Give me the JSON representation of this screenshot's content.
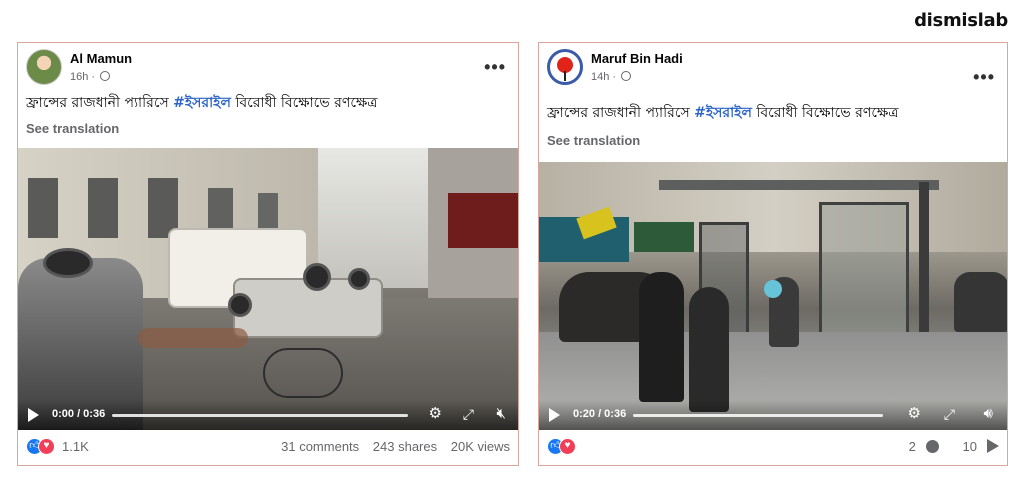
{
  "brand": "dismislab",
  "posts": [
    {
      "author": "Al Mamun",
      "time": "16h ·",
      "text_before": "ফ্রান্সের রাজধানী প্যারিসে ",
      "hashtag": "#ইসরাইল",
      "text_after": " বিরোধী বিক্ষোভে রণক্ষেত্র",
      "see_translation": "See translation",
      "video": {
        "time": "0:00 / 0:36",
        "progress": 0
      },
      "reaction_count": "1.1K",
      "comments": "31 comments",
      "shares": "243 shares",
      "views": "20K views",
      "icons": {
        "more": "more-options-icon",
        "globe": "globe-icon",
        "play": "play-icon",
        "settings": "settings-icon",
        "fullscreen": "fullscreen-icon",
        "mute": "mute-icon"
      }
    },
    {
      "author": "Maruf Bin Hadi",
      "time": "14h ·",
      "text_before": "ফ্রান্সের রাজধানী প্যারিসে ",
      "hashtag": "#ইসরাইল",
      "text_after": " বিরোধী বিক্ষোভে রণক্ষেত্র",
      "see_translation": "See translation",
      "video": {
        "time": "0:20 / 0:36",
        "progress": 0.56
      },
      "comment_count": "2",
      "share_count": "10",
      "icons": {
        "more": "more-options-icon",
        "globe": "globe-icon",
        "play": "play-icon",
        "settings": "settings-icon",
        "fullscreen": "fullscreen-icon",
        "volume": "volume-icon"
      }
    }
  ],
  "colors": {
    "hashtag": "#2d66c7",
    "like": "#1877f2",
    "love": "#f33e58",
    "border": "#d9a79e"
  }
}
